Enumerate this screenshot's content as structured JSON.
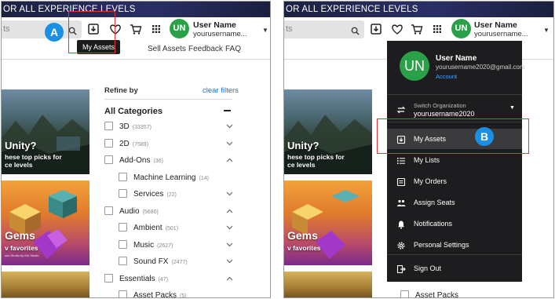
{
  "banner_text": "OR ALL EXPERIENCE LEVELS",
  "search_placeholder": "ts",
  "user": {
    "initials": "UN",
    "name": "User Name",
    "username_short": "yourusername...",
    "email": "yourusername2020@gmail.com",
    "account_link": "Account"
  },
  "nav_links": [
    "Sell Assets",
    "Feedback",
    "FAQ"
  ],
  "tooltip": "My Assets",
  "callouts": {
    "a": "A",
    "b": "B"
  },
  "sidebar": {
    "refine_by": "Refine by",
    "clear_filters": "clear filters",
    "all_categories": "All Categories",
    "categories": [
      {
        "label": "3D",
        "count": "(33357)",
        "level": 0,
        "expanded": false
      },
      {
        "label": "2D",
        "count": "(7589)",
        "level": 0,
        "expanded": false
      },
      {
        "label": "Add-Ons",
        "count": "(36)",
        "level": 0,
        "expanded": true
      },
      {
        "label": "Machine Learning",
        "count": "(14)",
        "level": 1,
        "expanded": null
      },
      {
        "label": "Services",
        "count": "(22)",
        "level": 1,
        "expanded": false
      },
      {
        "label": "Audio",
        "count": "(5680)",
        "level": 0,
        "expanded": true
      },
      {
        "label": "Ambient",
        "count": "(501)",
        "level": 1,
        "expanded": false
      },
      {
        "label": "Music",
        "count": "(2627)",
        "level": 1,
        "expanded": false
      },
      {
        "label": "Sound FX",
        "count": "(2477)",
        "level": 1,
        "expanded": false
      },
      {
        "label": "Essentials",
        "count": "(47)",
        "level": 0,
        "expanded": true
      },
      {
        "label": "Asset Packs",
        "count": "(5)",
        "level": 1,
        "expanded": null
      }
    ]
  },
  "thumbnails": [
    {
      "title": "Unity?",
      "subtitle_lines": [
        "hese top picks for",
        "ce levels"
      ],
      "fineprint": ""
    },
    {
      "title": "Gems",
      "subtitle_lines": [
        "v favorites"
      ],
      "fineprint": "son Studio by Kiri Studio"
    }
  ],
  "dropdown": {
    "switch_org_label": "Switch Organization",
    "org_name": "yourusername2020",
    "items": [
      {
        "label": "My Assets",
        "icon": "download-box-icon"
      },
      {
        "label": "My Lists",
        "icon": "list-icon"
      },
      {
        "label": "My Orders",
        "icon": "orders-icon"
      },
      {
        "label": "Assign Seats",
        "icon": "seats-icon"
      },
      {
        "label": "Notifications",
        "icon": "bell-icon"
      },
      {
        "label": "Personal Settings",
        "icon": "gear-icon"
      },
      {
        "label": "Sign Out",
        "icon": "sign-out-icon"
      }
    ]
  },
  "right_bottom_item": "Asset Packs",
  "colors": {
    "banner": "#1d2140",
    "avatar": "#2aa149",
    "link": "#1a73c9",
    "callout_border": "#e2343c",
    "badge": "#1a8fe3",
    "dropdown_bg": "#1d1d1f"
  }
}
